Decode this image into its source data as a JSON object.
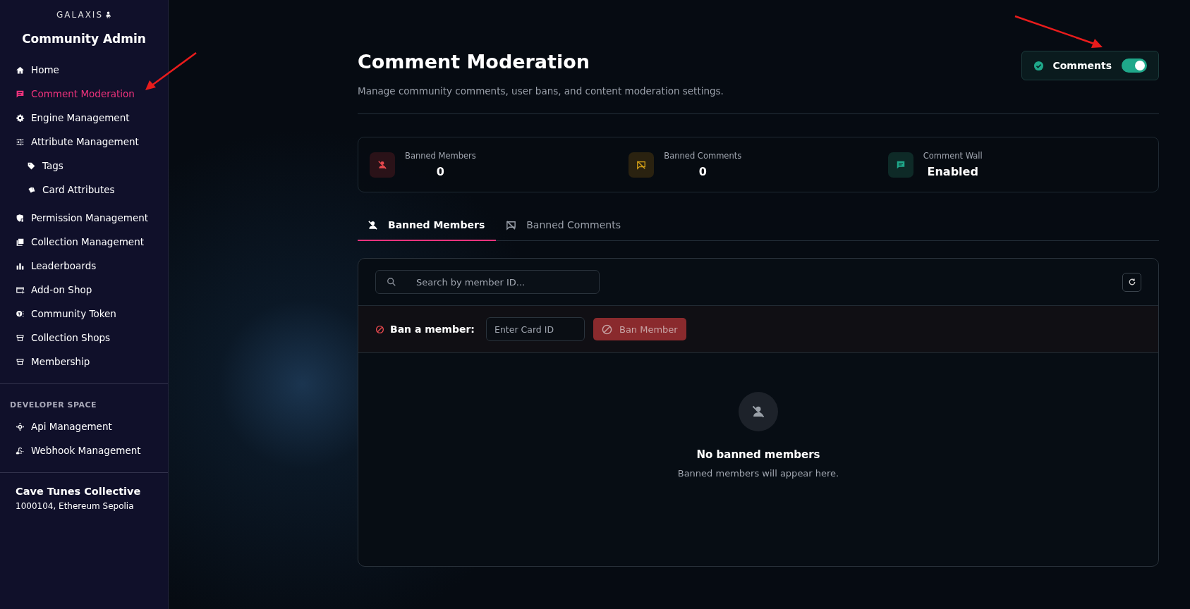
{
  "sidebar": {
    "logo": "GALAXIS",
    "title": "Community Admin",
    "items": [
      {
        "label": "Home",
        "selected": false
      },
      {
        "label": "Comment Moderation",
        "selected": true
      },
      {
        "label": "Engine Management",
        "selected": false
      },
      {
        "label": "Attribute Management",
        "selected": false,
        "children": [
          {
            "label": "Tags",
            "selected": false
          },
          {
            "label": "Card Attributes",
            "selected": false
          }
        ]
      },
      {
        "label": "Permission Management",
        "selected": false
      },
      {
        "label": "Collection Management",
        "selected": false
      },
      {
        "label": "Leaderboards",
        "selected": false
      },
      {
        "label": "Add-on Shop",
        "selected": false
      },
      {
        "label": "Community Token",
        "selected": false
      },
      {
        "label": "Collection Shops",
        "selected": false
      },
      {
        "label": "Membership",
        "selected": false
      }
    ],
    "section_heading": "DEVELOPER SPACE",
    "dev_items": [
      {
        "label": "Api Management",
        "selected": false
      },
      {
        "label": "Webhook Management",
        "selected": false
      }
    ],
    "community_name": "Cave Tunes Collective",
    "community_info": "1000104, Ethereum Sepolia"
  },
  "header": {
    "title": "Comment Moderation",
    "subtitle": "Manage community comments, user bans, and content moderation settings.",
    "toggle": {
      "label": "Comments",
      "on": true
    }
  },
  "stats": [
    {
      "label": "Banned Members",
      "value": "0",
      "kind": "members"
    },
    {
      "label": "Banned Comments",
      "value": "0",
      "kind": "comments"
    },
    {
      "label": "Comment Wall",
      "value": "Enabled",
      "kind": "wall"
    }
  ],
  "tabs": [
    {
      "label": "Banned Members",
      "selected": true,
      "kind": "members"
    },
    {
      "label": "Banned Comments",
      "selected": false,
      "kind": "comments"
    }
  ],
  "panel": {
    "search": {
      "placeholder": "Search by member ID..."
    },
    "ban_label": "Ban a member:",
    "card_field": {
      "placeholder": "Enter Card ID"
    },
    "ban_button": {
      "label": "Ban Member",
      "disabled": true
    },
    "empty_title": "No banned members",
    "empty_text": "Banned members will appear here."
  }
}
